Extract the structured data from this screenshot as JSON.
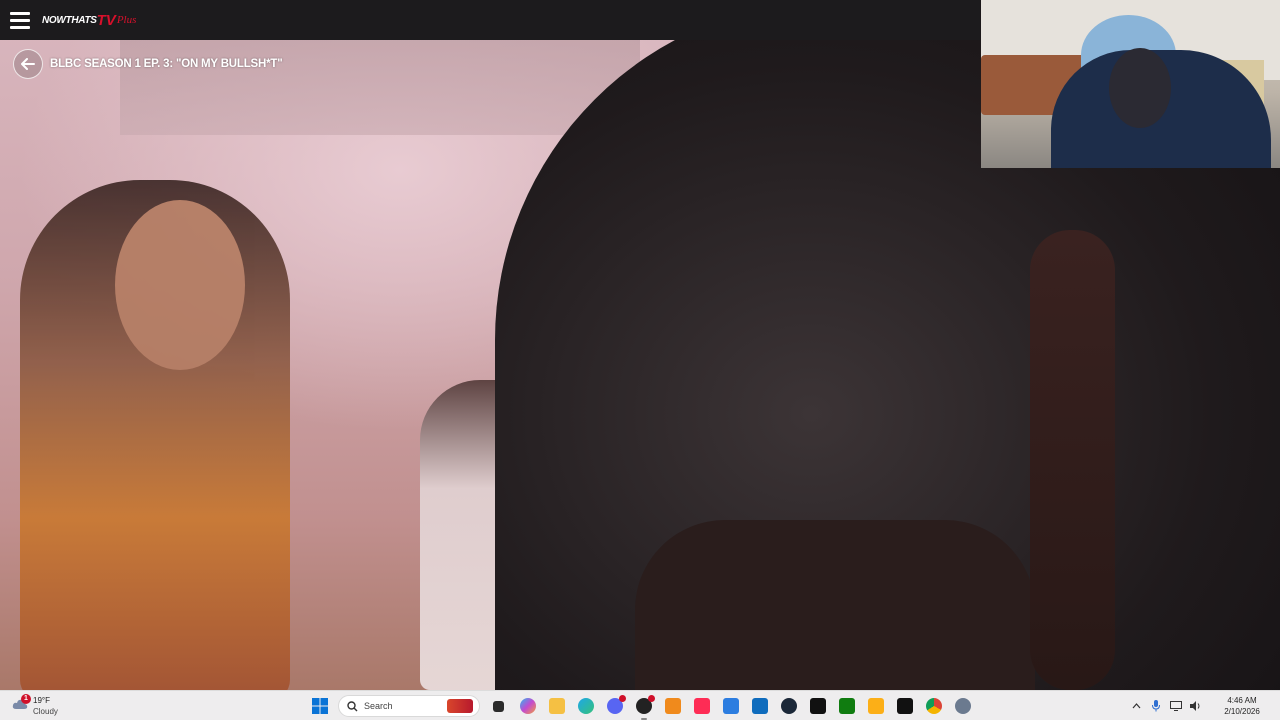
{
  "app": {
    "logo_part1": "NOWTHATS",
    "logo_part2": "TV",
    "logo_part3": "Plus"
  },
  "player": {
    "episode_title": "BLBC SEASON 1 EP. 3: \"ON MY BULLSH*T\""
  },
  "taskbar": {
    "weather": {
      "badge": "1",
      "temperature": "19°F",
      "condition": "Cloudy"
    },
    "search": {
      "label": "Search"
    },
    "pinned_apps": [
      {
        "name": "task-view-icon"
      },
      {
        "name": "copilot-icon"
      },
      {
        "name": "file-explorer-icon"
      },
      {
        "name": "edge-icon"
      },
      {
        "name": "discord-icon"
      },
      {
        "name": "obs-icon"
      },
      {
        "name": "vlc-icon"
      },
      {
        "name": "tiktok-studio-icon"
      },
      {
        "name": "ms-store-icon"
      },
      {
        "name": "outlook-icon"
      },
      {
        "name": "steam-icon"
      },
      {
        "name": "tiktok-icon"
      },
      {
        "name": "xbox-icon"
      },
      {
        "name": "rockstar-icon"
      },
      {
        "name": "fullscreen-app-icon"
      },
      {
        "name": "chrome-icon"
      },
      {
        "name": "settings-icon"
      }
    ],
    "clock": {
      "time": "4:46 AM",
      "date": "2/10/2026"
    }
  },
  "colors": {
    "appbar_bg": "#1c1b1d",
    "brand_red": "#d7102b",
    "taskbar_bg": "#eeedee"
  }
}
